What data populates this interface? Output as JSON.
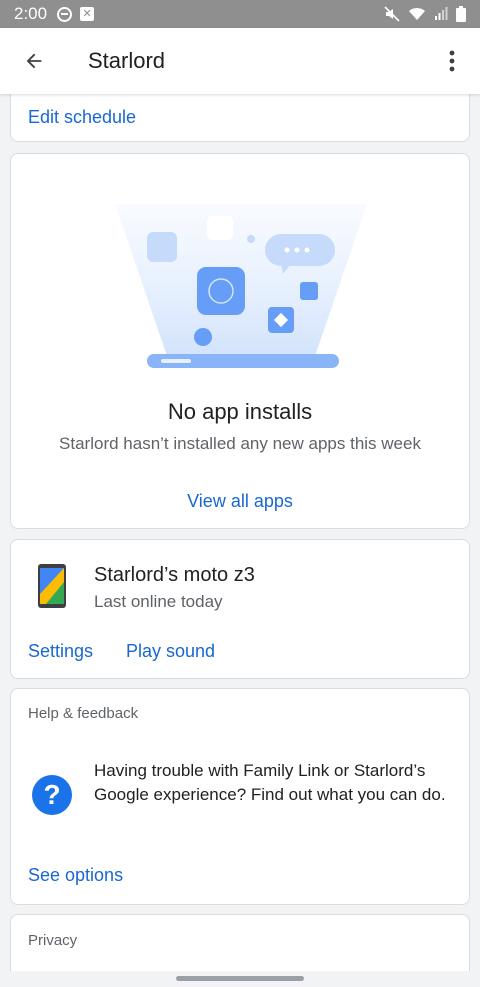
{
  "status_bar": {
    "time": "2:00"
  },
  "app_bar": {
    "title": "Starlord"
  },
  "schedule_card": {
    "link": "Edit schedule"
  },
  "apps_card": {
    "title": "No app installs",
    "subtitle": "Starlord hasn’t installed any new apps this week",
    "link": "View all apps"
  },
  "device_card": {
    "name": "Starlord’s moto z3",
    "status": "Last online today",
    "settings_label": "Settings",
    "play_sound_label": "Play sound"
  },
  "help_card": {
    "header": "Help & feedback",
    "icon_glyph": "?",
    "text": "Having trouble with Family Link or Starlord’s Google experience? Find out what you can do.",
    "link": "See options"
  },
  "privacy_card": {
    "header": "Privacy"
  },
  "icons": {
    "back": "arrow-back-icon",
    "more": "more-vert-icon",
    "help": "help-icon",
    "device": "phone-icon"
  },
  "colors": {
    "accent": "#1967d2",
    "status_bar": "#8f8f8f",
    "background": "#f1f3f4"
  }
}
